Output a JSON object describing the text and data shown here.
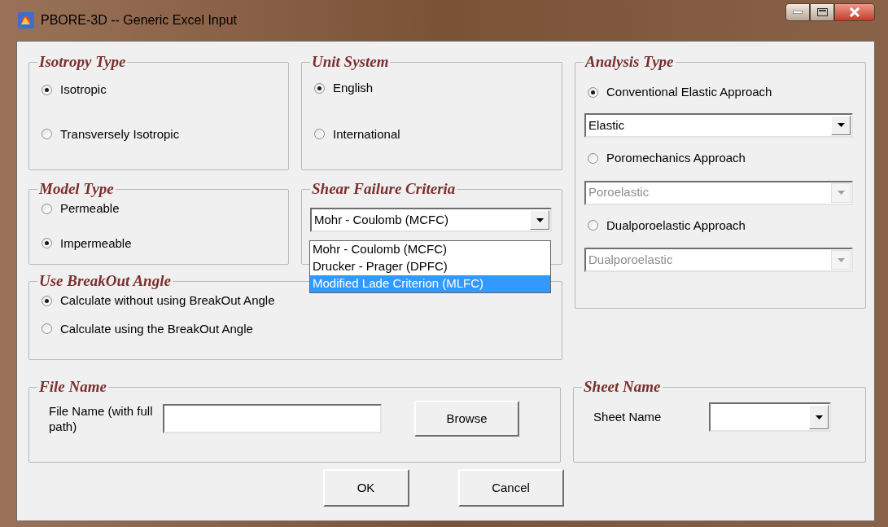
{
  "window": {
    "title": "PBORE-3D -- Generic Excel Input"
  },
  "isotropy_type": {
    "title": "Isotropy Type",
    "options": [
      {
        "label": "Isotropic",
        "selected": true
      },
      {
        "label": "Transversely Isotropic",
        "selected": false
      }
    ]
  },
  "unit_system": {
    "title": "Unit System",
    "options": [
      {
        "label": "English",
        "selected": true
      },
      {
        "label": "International",
        "selected": false
      }
    ]
  },
  "model_type": {
    "title": "Model Type",
    "options": [
      {
        "label": "Permeable",
        "selected": false
      },
      {
        "label": "Impermeable",
        "selected": true
      }
    ]
  },
  "shear_failure_criteria": {
    "title": "Shear Failure Criteria",
    "value": "Mohr - Coulomb (MCFC)",
    "expanded": true,
    "options": [
      {
        "label": "Mohr - Coulomb (MCFC)",
        "highlighted": false
      },
      {
        "label": "Drucker - Prager (DPFC)",
        "highlighted": false
      },
      {
        "label": "Modified Lade Criterion (MLFC)",
        "highlighted": true
      }
    ]
  },
  "use_breakout_angle": {
    "title": "Use BreakOut Angle",
    "options": [
      {
        "label": "Calculate without using BreakOut Angle",
        "selected": true
      },
      {
        "label": "Calculate using the BreakOut Angle",
        "selected": false
      }
    ]
  },
  "analysis_type": {
    "title": "Analysis Type",
    "items": [
      {
        "kind": "radio",
        "label": "Conventional Elastic Approach",
        "selected": true
      },
      {
        "kind": "dropdown",
        "value": "Elastic",
        "disabled": false
      },
      {
        "kind": "radio",
        "label": "Poromechanics Approach",
        "selected": false
      },
      {
        "kind": "dropdown",
        "value": "Poroelastic",
        "disabled": true
      },
      {
        "kind": "radio",
        "label": "Dualporoelastic Approach",
        "selected": false
      },
      {
        "kind": "dropdown",
        "value": "Dualporoelastic",
        "disabled": true
      }
    ]
  },
  "file_name": {
    "title": "File Name",
    "label": "File Name (with full path)",
    "button": "Browse"
  },
  "sheet_name": {
    "title": "Sheet Name",
    "label": "Sheet Name"
  },
  "buttons": [
    "OK",
    "Cancel"
  ]
}
